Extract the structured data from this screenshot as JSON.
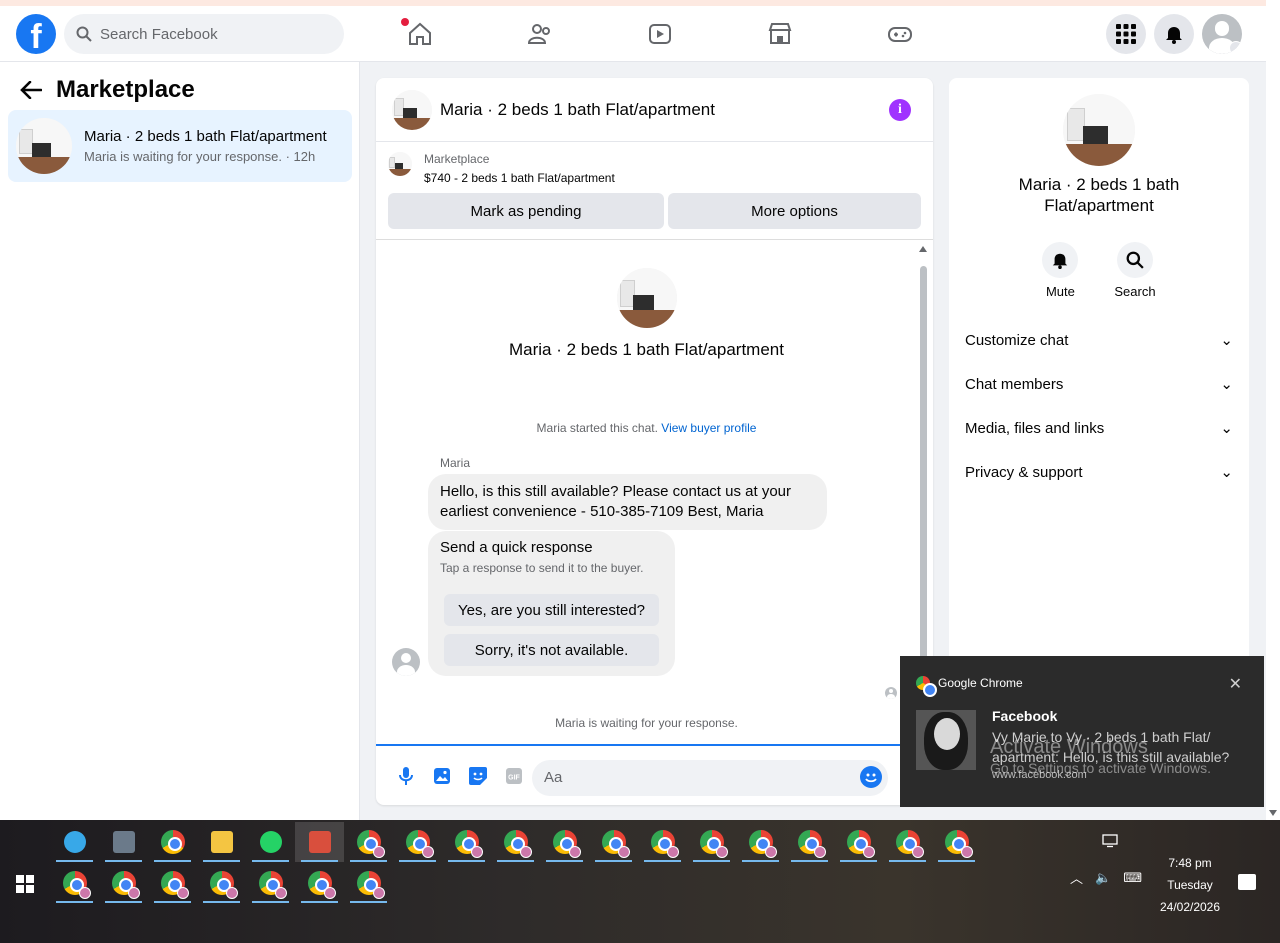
{
  "topbar": {
    "logo": "f",
    "search_placeholder": "Search Facebook",
    "nav": [
      "home-icon",
      "friends-icon",
      "watch-icon",
      "marketplace-icon",
      "gaming-icon"
    ],
    "right": [
      "menu-grid-icon",
      "notifications-bell-icon",
      "account-avatar"
    ]
  },
  "left": {
    "title": "Marketplace",
    "item": {
      "name": "Maria · 2 beds 1 bath Flat/apartment",
      "sub": "Maria is waiting for your response. · 12h"
    }
  },
  "chat": {
    "title": "Maria · 2 beds 1 bath Flat/apartment",
    "listing_label": "Marketplace",
    "listing_price": "$740 - 2 beds 1 bath Flat/apartment",
    "mark_pending": "Mark as pending",
    "more_options": "More options",
    "profile_title": "Maria · 2 beds 1 bath Flat/apartment",
    "started_text": "Maria started this chat.",
    "buyer_link": "View buyer profile",
    "sender": "Maria",
    "message": "Hello, is this still available? Please contact us at your earliest convenience - 510-385-7109 Best, Maria",
    "quick_title": "Send a quick response",
    "quick_sub": "Tap a response to send it to the buyer.",
    "quick_1": "Yes, are you still interested?",
    "quick_2": "Sorry, it's not available.",
    "waiting": "Maria is waiting for your response.",
    "composer_placeholder": "Aa",
    "composer_icons": [
      "microphone-icon",
      "image-icon",
      "sticker-icon",
      "gif-icon"
    ]
  },
  "right": {
    "title": "Maria · 2 beds 1 bath Flat/apartment",
    "mute": "Mute",
    "search": "Search",
    "rows": [
      "Customize chat",
      "Chat members",
      "Media, files and links",
      "Privacy & support"
    ]
  },
  "toast": {
    "app": "Google Chrome",
    "title": "Facebook",
    "message": "Vy Marie to Vy · 2 beds 1 bath Flat/ apartment: Hello, is this still available?",
    "url": "www.facebook.com"
  },
  "watermark": {
    "line1": "Activate Windows",
    "line2": "Go to Settings to activate Windows."
  },
  "taskbar": {
    "time": "7:48 pm",
    "day": "Tuesday",
    "date": "24/02/2026",
    "row1_apps": [
      "app-icon",
      "calculator-icon",
      "chrome-icon",
      "file-explorer-icon",
      "whatsapp-icon",
      "snipping-tool-icon",
      "chrome-profile-icon",
      "chrome-profile-icon",
      "chrome-profile-icon",
      "chrome-profile-icon",
      "chrome-profile-icon",
      "chrome-profile-icon",
      "chrome-profile-icon",
      "chrome-profile-icon",
      "chrome-profile-icon",
      "chrome-profile-icon",
      "chrome-profile-icon",
      "chrome-profile-icon",
      "chrome-profile-icon"
    ],
    "row2_apps": [
      "chrome-profile-icon",
      "chrome-profile-icon",
      "chrome-profile-icon",
      "chrome-profile-icon",
      "chrome-profile-icon",
      "chrome-profile-icon",
      "chrome-profile-icon"
    ]
  },
  "colors": {
    "brand": "#1877f2",
    "accent_purple": "#a033ff",
    "selected_bg": "#e7f3ff"
  }
}
